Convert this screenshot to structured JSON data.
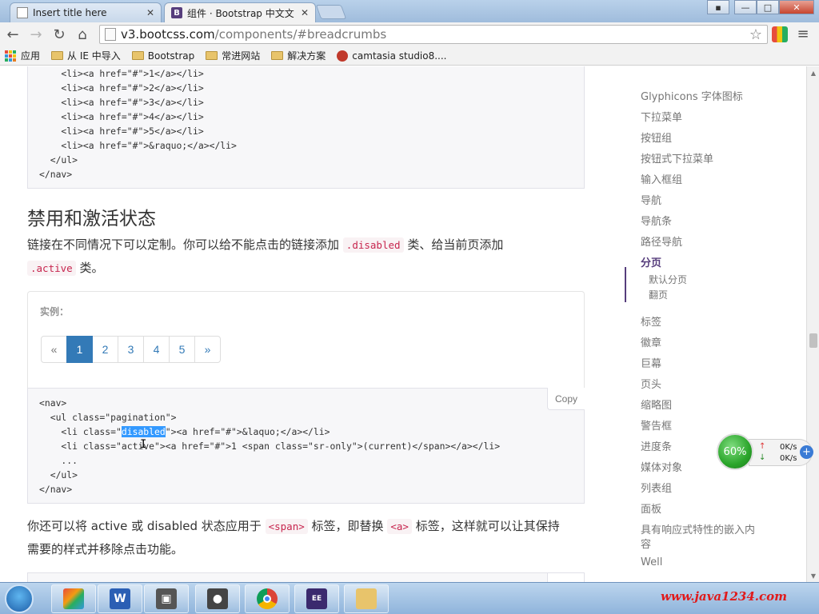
{
  "tabs": [
    {
      "title": "Insert title here",
      "icon": "page-icon"
    },
    {
      "title": "组件 · Bootstrap 中文文",
      "icon": "bootstrap-icon"
    }
  ],
  "window_controls": {
    "minimize": "—",
    "maximize": "□",
    "close": "✕"
  },
  "address_bar": {
    "host": "v3.bootcss.com",
    "path": "/components/#breadcrumbs"
  },
  "bookmarks": [
    "应用",
    "从 IE 中导入",
    "Bootstrap",
    "常进网站",
    "解决方案",
    "camtasia studio8...."
  ],
  "top_code": [
    "    <li><a href=\"#\">1</a></li>",
    "    <li><a href=\"#\">2</a></li>",
    "    <li><a href=\"#\">3</a></li>",
    "    <li><a href=\"#\">4</a></li>",
    "    <li><a href=\"#\">5</a></li>",
    "    <li><a href=\"#\">&raquo;</a></li>",
    "  </ul>",
    "</nav>"
  ],
  "section": {
    "title": "禁用和激活状态",
    "desc_part1": "链接在不同情况下可以定制。你可以给不能点击的链接添加",
    "desc_code1": ".disabled",
    "desc_part2": "类、给当前页添加",
    "desc_code2": ".active",
    "desc_part3": "类。"
  },
  "example": {
    "label": "实例：",
    "pagination": [
      {
        "label": "«",
        "state": "disabled"
      },
      {
        "label": "1",
        "state": "active"
      },
      {
        "label": "2",
        "state": ""
      },
      {
        "label": "3",
        "state": ""
      },
      {
        "label": "4",
        "state": ""
      },
      {
        "label": "5",
        "state": ""
      },
      {
        "label": "»",
        "state": ""
      }
    ]
  },
  "copy_label": "Copy",
  "example_code": {
    "l1": "<nav>",
    "l2": "  <ul class=\"pagination\">",
    "l3_pre": "    <li class=\"",
    "l3_hl": "disabled",
    "l3_post": "\"><a href=\"#\">&laquo;</a></li>",
    "l4": "    <li class=\"active\"><a href=\"#\">1 <span class=\"sr-only\">(current)</span></a></li>",
    "l5": "    ...",
    "l6": "  </ul>",
    "l7": "</nav>"
  },
  "para2": {
    "t1": "你还可以将 active 或 disabled 状态应用于",
    "c1": "<span>",
    "t2": "标签，即替换",
    "c2": "<a>",
    "t3": "标签，这样就可以让其保持",
    "t4": "需要的样式并移除点击功能。"
  },
  "sidenav": {
    "items": [
      "Glyphicons 字体图标",
      "下拉菜单",
      "按钮组",
      "按钮式下拉菜单",
      "输入框组",
      "导航",
      "导航条",
      "路径导航"
    ],
    "active": "分页",
    "subitems": [
      "默认分页",
      "翻页"
    ],
    "items_after": [
      "标签",
      "徽章",
      "巨幕",
      "页头",
      "缩略图",
      "警告框",
      "进度条",
      "媒体对象",
      "列表组",
      "面板",
      "具有响应式特性的嵌入内",
      "容",
      "Well"
    ]
  },
  "net_widget": {
    "percent": "60%",
    "up": "0K/s",
    "down": "0K/s"
  },
  "taskbar": {
    "watermark": "www.java1234.com"
  },
  "colors": {
    "accent": "#337ab7",
    "bootstrap_purple": "#563d7c",
    "code_red": "#c7254e"
  }
}
